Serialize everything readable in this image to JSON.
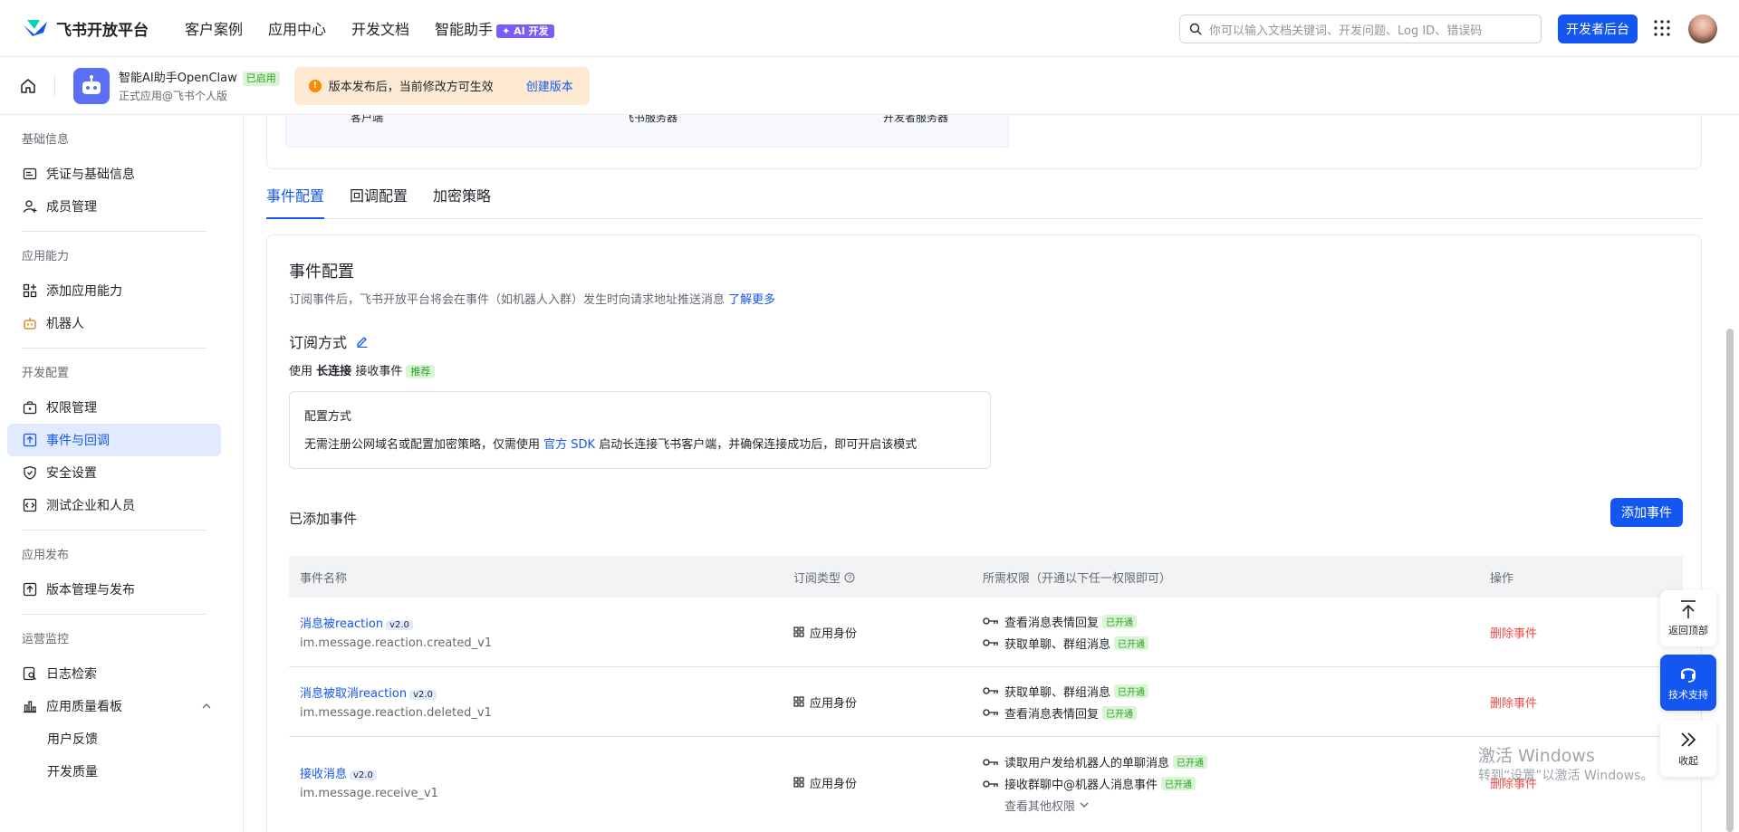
{
  "brand": {
    "name": "飞书开放平台"
  },
  "topnav": {
    "items": [
      "客户案例",
      "应用中心",
      "开发文档",
      "智能助手"
    ],
    "ai_badge": "AI 开发"
  },
  "search": {
    "placeholder": "你可以输入文档关键词、开发问题、Log ID、错误码"
  },
  "dev_console_label": "开发者后台",
  "app": {
    "name": "智能AI助手OpenClaw",
    "status": "已启用",
    "subtitle": "正式应用@飞书个人版"
  },
  "notice": {
    "text": "版本发布后，当前修改方可生效",
    "link": "创建版本"
  },
  "sidebar": {
    "sections": [
      {
        "title": "基础信息",
        "items": [
          "凭证与基础信息",
          "成员管理"
        ]
      },
      {
        "title": "应用能力",
        "items": [
          "添加应用能力",
          "机器人"
        ]
      },
      {
        "title": "开发配置",
        "items": [
          "权限管理",
          "事件与回调",
          "安全设置",
          "测试企业和人员"
        ]
      },
      {
        "title": "应用发布",
        "items": [
          "版本管理与发布"
        ]
      },
      {
        "title": "运营监控",
        "items": [
          "日志检索",
          "应用质量看板"
        ],
        "subitems": [
          "用户反馈",
          "开发质量"
        ]
      }
    ],
    "active": "事件与回调"
  },
  "topcard": {
    "labels": [
      "客户端",
      "飞书服务器",
      "开发者服务器"
    ]
  },
  "tabs": [
    "事件配置",
    "回调配置",
    "加密策略"
  ],
  "event_config": {
    "title": "事件配置",
    "desc": "订阅事件后，飞书开放平台将会在事件（如机器人入群）发生时向请求地址推送消息",
    "learn_more": "了解更多",
    "subscribe_title": "订阅方式",
    "mode_prefix": "使用",
    "mode_bold": "长连接",
    "mode_suffix": "接收事件",
    "mode_tag": "推荐",
    "cfg_title": "配置方式",
    "cfg_text_a": "无需注册公网域名或配置加密策略，仅需使用",
    "cfg_link": "官方 SDK",
    "cfg_text_b": "启动长连接飞书客户端，并确保连接成功后，即可开启该模式"
  },
  "added": {
    "title": "已添加事件",
    "add_button": "添加事件",
    "columns": [
      "事件名称",
      "订阅类型",
      "所需权限（开通以下任一权限即可）",
      "操作"
    ],
    "rows": [
      {
        "name": "消息被reaction",
        "version": "v2.0",
        "code": "im.message.reaction.created_v1",
        "type": "应用身份",
        "perms": [
          {
            "name": "查看消息表情回复",
            "status": "已开通"
          },
          {
            "name": "获取单聊、群组消息",
            "status": "已开通"
          }
        ],
        "action": "删除事件"
      },
      {
        "name": "消息被取消reaction",
        "version": "v2.0",
        "code": "im.message.reaction.deleted_v1",
        "type": "应用身份",
        "perms": [
          {
            "name": "获取单聊、群组消息",
            "status": "已开通"
          },
          {
            "name": "查看消息表情回复",
            "status": "已开通"
          }
        ],
        "action": "删除事件"
      },
      {
        "name": "接收消息",
        "version": "v2.0",
        "code": "im.message.receive_v1",
        "type": "应用身份",
        "perms": [
          {
            "name": "读取用户发给机器人的单聊消息",
            "status": "已开通"
          },
          {
            "name": "接收群聊中@机器人消息事件",
            "status": "已开通"
          }
        ],
        "more": "查看其他权限",
        "action": "删除事件"
      }
    ]
  },
  "float": {
    "top": "返回顶部",
    "support": "技术支持",
    "collapse": "收起"
  },
  "watermark": {
    "line1": "激活 Windows",
    "line2": "转到“设置”以激活 Windows。"
  }
}
